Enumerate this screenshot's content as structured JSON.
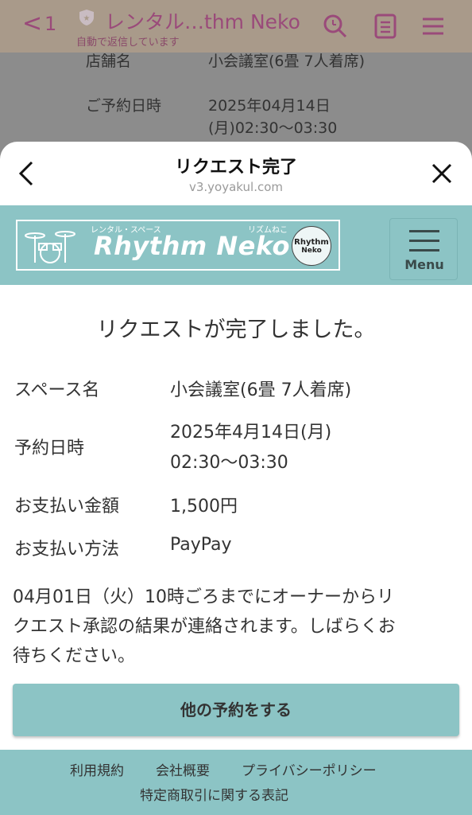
{
  "chat": {
    "back_glyph": "<",
    "unread_count": "1",
    "title": "レンタル…thm Neko",
    "subtitle": "自動で返信しています",
    "bg_store_label": "店舗名",
    "bg_store_value": "小会議室(6畳 7人着席)",
    "bg_date_label": "ご予約日時",
    "bg_date_value_line1": "2025年04月14日",
    "bg_date_value_line2": "(月)02:30～03:30"
  },
  "sheet": {
    "title": "リクエスト完了",
    "url": "v3.yoyakul.com"
  },
  "site": {
    "logo_text": "Rhythm Neko",
    "logo_small": "レンタル・スペース",
    "logo_kana": "リズムねこ",
    "badge_line1": "Rhythm",
    "badge_line2": "Neko",
    "menu_label": "Menu"
  },
  "content": {
    "heading": "リクエストが完了しました。",
    "details": [
      {
        "label": "スペース名",
        "value": "小会議室(6畳 7人着席)"
      },
      {
        "label": "予約日時",
        "value": "2025年4月14日(月)",
        "value2": "02:30～03:30"
      },
      {
        "label": "お支払い金額",
        "value": "1,500円"
      },
      {
        "label": "お支払い方法",
        "value": "PayPay"
      }
    ],
    "notice_line1": "04月01日（火）10時ごろまでにオーナーからリ",
    "notice_line2": "クエスト承認の結果が連絡されます。しばらくお",
    "notice_line3": "待ちください。",
    "other_button": "他の予約をする"
  },
  "footer": {
    "terms": "利用規約",
    "company": "会社概要",
    "privacy": "プライバシーポリシー",
    "commerce": "特定商取引に関する表記"
  },
  "colors": {
    "accent_teal": "#8cc4c5",
    "chat_header": "#a99a8a"
  }
}
